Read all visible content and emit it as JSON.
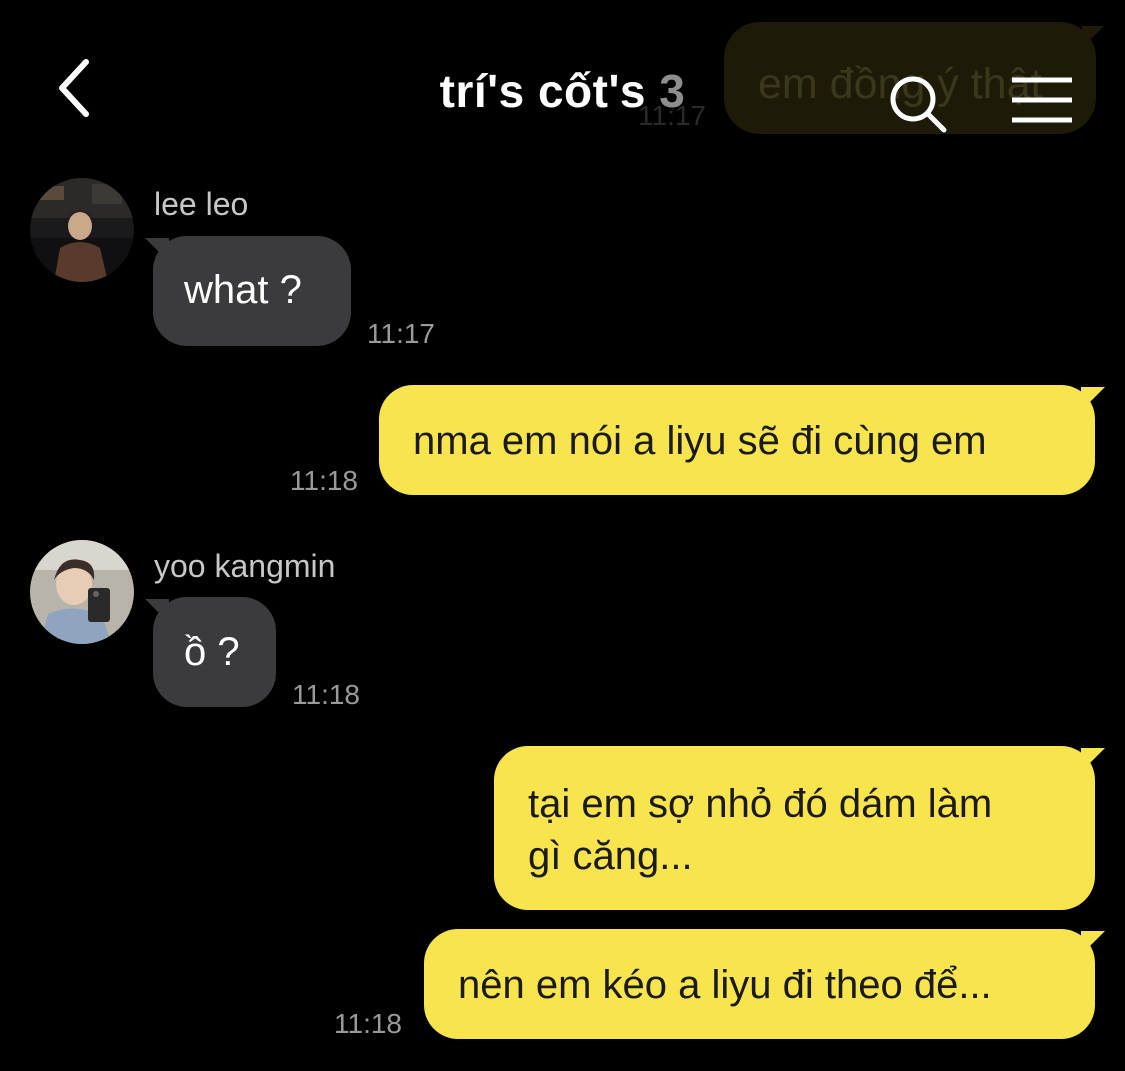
{
  "header": {
    "title": "trí's cốt's",
    "member_count": "3",
    "back_icon": "chevron-left-icon",
    "search_icon": "search-icon",
    "menu_icon": "menu-icon"
  },
  "background_message": {
    "text": "em đồng ý thật",
    "time": "11:17"
  },
  "messages": [
    {
      "direction": "received",
      "sender": "lee leo",
      "text": "what ?",
      "time": "11:17"
    },
    {
      "direction": "sent",
      "text": "nma em nói a liyu sẽ đi cùng em",
      "time": "11:18"
    },
    {
      "direction": "received",
      "sender": "yoo kangmin",
      "text": "ồ ?",
      "time": "11:18"
    },
    {
      "direction": "sent",
      "lines": [
        "tại em sợ nhỏ đó dám làm",
        "gì căng..."
      ]
    },
    {
      "direction": "sent",
      "text": "nên em kéo a liyu đi theo để...",
      "time": "11:18"
    }
  ],
  "colors": {
    "background": "#000000",
    "sent_bubble": "#f8e44c",
    "received_bubble": "#3b3b3d",
    "timestamp": "#9a9a9a"
  }
}
